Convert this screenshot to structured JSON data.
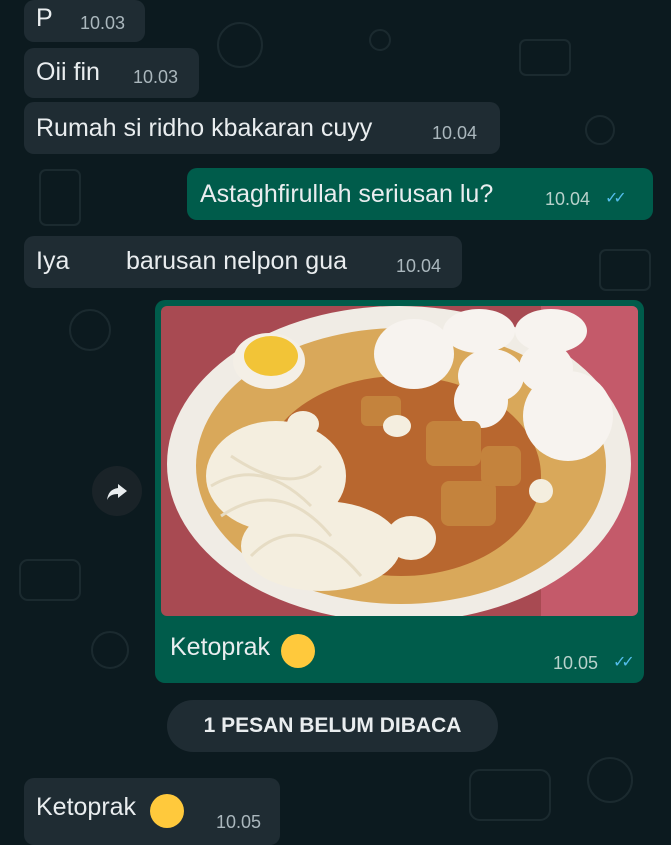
{
  "messages": [
    {
      "text": "P",
      "time": "10.03"
    },
    {
      "text": "Oii fin",
      "time": "10.03"
    },
    {
      "text": "Rumah si ridho kbakaran cuyy",
      "time": "10.04"
    },
    {
      "text": "Astaghfirullah seriusan lu?",
      "time": "10.04"
    },
    {
      "text": "Iya",
      "text2": "barusan nelpon gua",
      "time": "10.04"
    },
    {
      "text": "Ketoprak",
      "time": "10.05"
    },
    {
      "text": "Ketoprak",
      "time": "10.05"
    }
  ],
  "unread_banner": "1 PESAN BELUM DIBACA",
  "icons": [
    "forward-arrow-icon",
    "double-check-icon",
    "drooling-face-emoji-icon"
  ],
  "colors": {
    "incoming": "#1f2c33",
    "outgoing": "#005c4b",
    "read_ticks": "#53bdeb",
    "background": "#0c1a1f"
  }
}
